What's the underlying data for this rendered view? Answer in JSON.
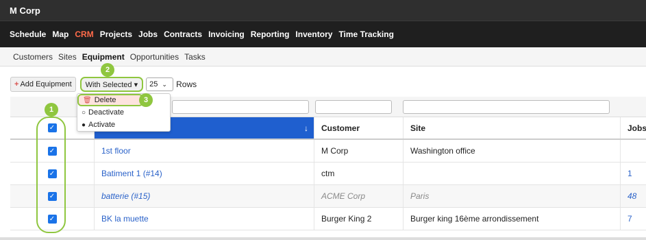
{
  "app": {
    "title": "M Corp"
  },
  "mainnav": {
    "items": [
      "Schedule",
      "Map",
      "CRM",
      "Projects",
      "Jobs",
      "Contracts",
      "Invoicing",
      "Reporting",
      "Inventory",
      "Time Tracking"
    ],
    "active": "CRM"
  },
  "subnav": {
    "items": [
      "Customers",
      "Sites",
      "Equipment",
      "Opportunities",
      "Tasks"
    ],
    "active": "Equipment"
  },
  "toolbar": {
    "add_label": "Add Equipment",
    "with_selected_label": "With Selected ▾",
    "rows_value": "25",
    "rows_label": "Rows"
  },
  "dropdown": {
    "items": [
      {
        "label": "Delete",
        "icon": "trash-icon"
      },
      {
        "label": "Deactivate",
        "icon": "circle-outline-icon"
      },
      {
        "label": "Activate",
        "icon": "circle-filled-icon"
      }
    ]
  },
  "badges": [
    "1",
    "2",
    "3"
  ],
  "table": {
    "columns": [
      "",
      "Customer",
      "Site",
      "Jobs"
    ],
    "sort_icon": "↓",
    "rows": [
      {
        "name": "1st floor",
        "customer": "M Corp",
        "site": "Washington office",
        "jobs": "",
        "checked": true
      },
      {
        "name": "Batiment 1 (#14)",
        "customer": "ctm",
        "site": "",
        "jobs": "1",
        "checked": true
      },
      {
        "name": "batterie (#15)",
        "customer": "ACME Corp",
        "site": "Paris",
        "jobs": "48",
        "checked": true
      },
      {
        "name": "BK la muette",
        "customer": "Burger King 2",
        "site": "Burger king 16ème arrondissement",
        "jobs": "7",
        "checked": true
      }
    ]
  },
  "colors": {
    "accent": "#8fc63f",
    "active_nav": "#ff6b4a",
    "sorted_header": "#1f5fcf",
    "link": "#2a62c9"
  }
}
